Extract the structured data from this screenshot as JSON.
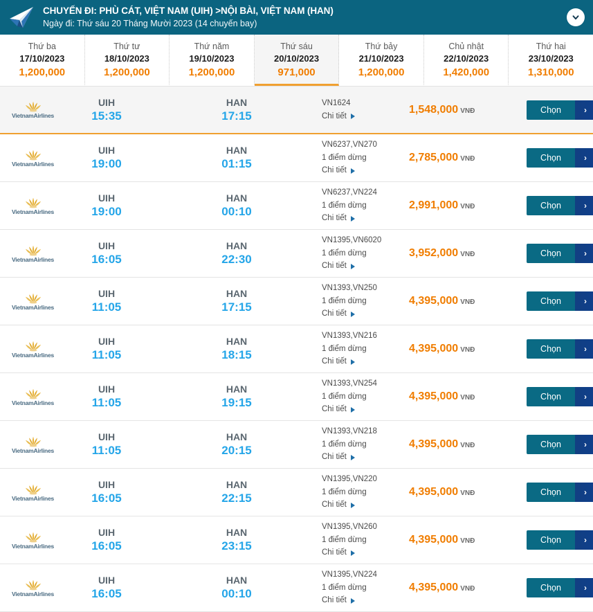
{
  "header": {
    "title": "CHUYẾN ĐI: PHÙ CÁT, VIỆT NAM (UIH) >NỘI BÀI, VIỆT NAM (HAN)",
    "subtitle": "Ngày đi: Thứ sáu 20 Tháng Mười 2023 (14 chuyến bay)",
    "plane_icon": "paper-plane-icon",
    "toggle_icon": "chevron-down-icon",
    "bg_color": "#0b6480"
  },
  "date_strip": {
    "dates": [
      {
        "dow": "Thứ ba",
        "date": "17/10/2023",
        "price": "1,200,000",
        "selected": false
      },
      {
        "dow": "Thứ tư",
        "date": "18/10/2023",
        "price": "1,200,000",
        "selected": false
      },
      {
        "dow": "Thứ năm",
        "date": "19/10/2023",
        "price": "1,200,000",
        "selected": false
      },
      {
        "dow": "Thứ sáu",
        "date": "20/10/2023",
        "price": "971,000",
        "selected": true
      },
      {
        "dow": "Thứ bảy",
        "date": "21/10/2023",
        "price": "1,200,000",
        "selected": false
      },
      {
        "dow": "Chủ nhật",
        "date": "22/10/2023",
        "price": "1,420,000",
        "selected": false
      },
      {
        "dow": "Thứ hai",
        "date": "23/10/2023",
        "price": "1,310,000",
        "selected": false
      }
    ],
    "accent_color": "#f0a030",
    "price_color": "#f07d00"
  },
  "labels": {
    "airline_name": "VietnamAirlines",
    "details_link": "Chi tiết",
    "currency": "VNĐ",
    "choose_button": "Chọn",
    "choose_arrow": "›"
  },
  "flights": [
    {
      "dep_code": "UIH",
      "dep_time": "15:35",
      "arr_code": "HAN",
      "arr_time": "17:15",
      "flight_codes": "VN1624",
      "stops": "",
      "price": "1,548,000",
      "best": true
    },
    {
      "dep_code": "UIH",
      "dep_time": "19:00",
      "arr_code": "HAN",
      "arr_time": "01:15",
      "flight_codes": "VN6237,VN270",
      "stops": "1 điểm dừng",
      "price": "2,785,000",
      "best": false
    },
    {
      "dep_code": "UIH",
      "dep_time": "19:00",
      "arr_code": "HAN",
      "arr_time": "00:10",
      "flight_codes": "VN6237,VN224",
      "stops": "1 điểm dừng",
      "price": "2,991,000",
      "best": false
    },
    {
      "dep_code": "UIH",
      "dep_time": "16:05",
      "arr_code": "HAN",
      "arr_time": "22:30",
      "flight_codes": "VN1395,VN6020",
      "stops": "1 điểm dừng",
      "price": "3,952,000",
      "best": false
    },
    {
      "dep_code": "UIH",
      "dep_time": "11:05",
      "arr_code": "HAN",
      "arr_time": "17:15",
      "flight_codes": "VN1393,VN250",
      "stops": "1 điểm dừng",
      "price": "4,395,000",
      "best": false
    },
    {
      "dep_code": "UIH",
      "dep_time": "11:05",
      "arr_code": "HAN",
      "arr_time": "18:15",
      "flight_codes": "VN1393,VN216",
      "stops": "1 điểm dừng",
      "price": "4,395,000",
      "best": false
    },
    {
      "dep_code": "UIH",
      "dep_time": "11:05",
      "arr_code": "HAN",
      "arr_time": "19:15",
      "flight_codes": "VN1393,VN254",
      "stops": "1 điểm dừng",
      "price": "4,395,000",
      "best": false
    },
    {
      "dep_code": "UIH",
      "dep_time": "11:05",
      "arr_code": "HAN",
      "arr_time": "20:15",
      "flight_codes": "VN1393,VN218",
      "stops": "1 điểm dừng",
      "price": "4,395,000",
      "best": false
    },
    {
      "dep_code": "UIH",
      "dep_time": "16:05",
      "arr_code": "HAN",
      "arr_time": "22:15",
      "flight_codes": "VN1395,VN220",
      "stops": "1 điểm dừng",
      "price": "4,395,000",
      "best": false
    },
    {
      "dep_code": "UIH",
      "dep_time": "16:05",
      "arr_code": "HAN",
      "arr_time": "23:15",
      "flight_codes": "VN1395,VN260",
      "stops": "1 điểm dừng",
      "price": "4,395,000",
      "best": false
    },
    {
      "dep_code": "UIH",
      "dep_time": "16:05",
      "arr_code": "HAN",
      "arr_time": "00:10",
      "flight_codes": "VN1395,VN224",
      "stops": "1 điểm dừng",
      "price": "4,395,000",
      "best": false
    }
  ]
}
